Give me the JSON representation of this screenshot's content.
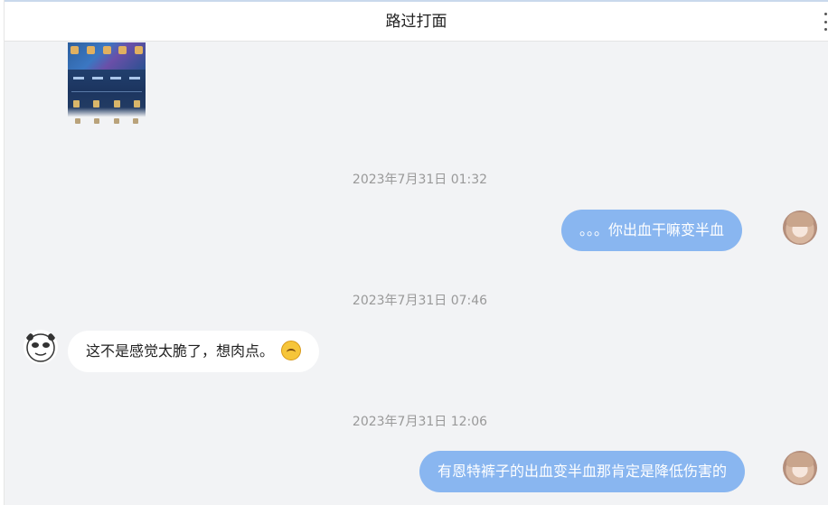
{
  "header": {
    "title": "路过打面"
  },
  "messages": {
    "m1_timestamp": "2023年7月31日 01:32",
    "m1_text": "。。。你出血干嘛变半血",
    "m2_timestamp": "2023年7月31日 07:46",
    "m2_text": "这不是感觉太脆了，想肉点。",
    "m3_timestamp": "2023年7月31日 12:06",
    "m3_text": "有恩特裤子的出血变半血那肯定是降低伤害的"
  },
  "icons": {
    "more": "more-vertical-icon",
    "emoji": "laugh-emoji-icon",
    "me_avatar": "anime-girl-avatar",
    "other_avatar": "panda-meme-avatar"
  },
  "colors": {
    "my_bubble": "#89b6f0",
    "their_bubble": "#ffffff",
    "background": "#f2f3f5",
    "timestamp": "#999999"
  }
}
